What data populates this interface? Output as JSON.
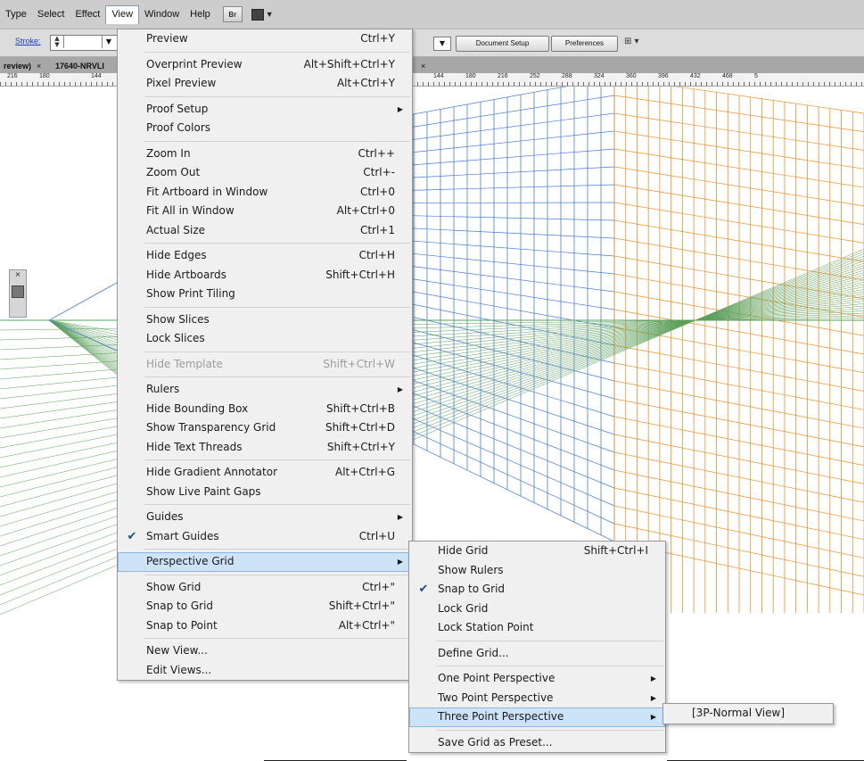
{
  "menubar": {
    "items": [
      "Type",
      "Select",
      "Effect",
      "View",
      "Window",
      "Help"
    ],
    "active": "View",
    "bridge_label": "Br",
    "workspace_icon": "workspace-switcher-icon"
  },
  "controlbar": {
    "stroke_label": "Stroke:",
    "document_setup": "Document Setup",
    "preferences": "Preferences"
  },
  "tabs": [
    {
      "label": "review)"
    },
    {
      "label": "17640-NRVLI"
    }
  ],
  "ruler_left": [
    "216",
    "180",
    "144"
  ],
  "ruler_right": [
    "144",
    "180",
    "216",
    "252",
    "288",
    "324",
    "360",
    "396",
    "432",
    "468",
    "5"
  ],
  "view_menu": [
    {
      "label": "Preview",
      "shortcut": "Ctrl+Y"
    },
    "sep",
    {
      "label": "Overprint Preview",
      "shortcut": "Alt+Shift+Ctrl+Y"
    },
    {
      "label": "Pixel Preview",
      "shortcut": "Alt+Ctrl+Y"
    },
    "sep",
    {
      "label": "Proof Setup",
      "submenu": true
    },
    {
      "label": "Proof Colors"
    },
    "sep",
    {
      "label": "Zoom In",
      "shortcut": "Ctrl++"
    },
    {
      "label": "Zoom Out",
      "shortcut": "Ctrl+-"
    },
    {
      "label": "Fit Artboard in Window",
      "shortcut": "Ctrl+0"
    },
    {
      "label": "Fit All in Window",
      "shortcut": "Alt+Ctrl+0"
    },
    {
      "label": "Actual Size",
      "shortcut": "Ctrl+1"
    },
    "sep",
    {
      "label": "Hide Edges",
      "shortcut": "Ctrl+H"
    },
    {
      "label": "Hide Artboards",
      "shortcut": "Shift+Ctrl+H"
    },
    {
      "label": "Show Print Tiling"
    },
    "sep",
    {
      "label": "Show Slices"
    },
    {
      "label": "Lock Slices"
    },
    "sep",
    {
      "label": "Hide Template",
      "shortcut": "Shift+Ctrl+W",
      "disabled": true
    },
    "sep",
    {
      "label": "Rulers",
      "submenu": true
    },
    {
      "label": "Hide Bounding Box",
      "shortcut": "Shift+Ctrl+B"
    },
    {
      "label": "Show Transparency Grid",
      "shortcut": "Shift+Ctrl+D"
    },
    {
      "label": "Hide Text Threads",
      "shortcut": "Shift+Ctrl+Y"
    },
    "sep",
    {
      "label": "Hide Gradient Annotator",
      "shortcut": "Alt+Ctrl+G"
    },
    {
      "label": "Show Live Paint Gaps"
    },
    "sep",
    {
      "label": "Guides",
      "submenu": true
    },
    {
      "label": "Smart Guides",
      "shortcut": "Ctrl+U",
      "checked": true
    },
    "sep",
    {
      "label": "Perspective Grid",
      "submenu": true,
      "highlighted": true
    },
    "sep",
    {
      "label": "Show Grid",
      "shortcut": "Ctrl+\""
    },
    {
      "label": "Snap to Grid",
      "shortcut": "Shift+Ctrl+\""
    },
    {
      "label": "Snap to Point",
      "shortcut": "Alt+Ctrl+\""
    },
    "sep",
    {
      "label": "New View..."
    },
    {
      "label": "Edit Views..."
    }
  ],
  "perspective_menu": [
    {
      "label": "Hide Grid",
      "shortcut": "Shift+Ctrl+I"
    },
    {
      "label": "Show Rulers"
    },
    {
      "label": "Snap to Grid",
      "checked": true
    },
    {
      "label": "Lock Grid"
    },
    {
      "label": "Lock Station Point"
    },
    "sep",
    {
      "label": "Define Grid..."
    },
    "sep",
    {
      "label": "One Point Perspective",
      "submenu": true
    },
    {
      "label": "Two Point Perspective",
      "submenu": true
    },
    {
      "label": "Three Point Perspective",
      "submenu": true,
      "highlighted": true
    },
    "sep",
    {
      "label": "Save Grid as Preset..."
    }
  ],
  "three_point_menu": [
    {
      "label": "[3P-Normal View]"
    }
  ],
  "colors": {
    "grid_left": "#4a7fd6",
    "grid_right": "#f0902a",
    "grid_ground": "#5aa05a",
    "menu_highlight": "#cde3f7"
  }
}
